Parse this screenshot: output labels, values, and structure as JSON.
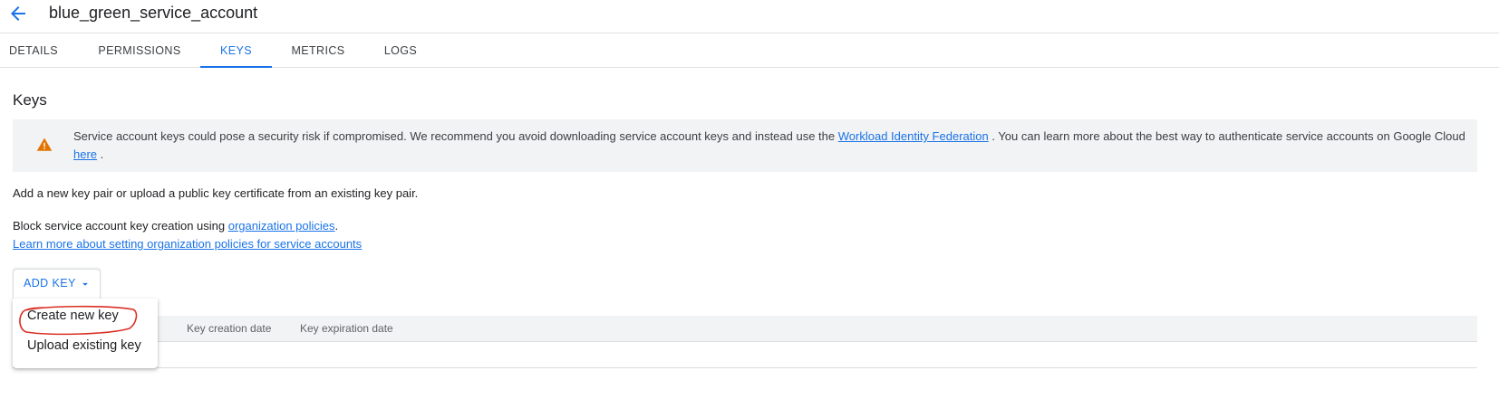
{
  "header": {
    "title": "blue_green_service_account",
    "back_icon": "arrow-back-icon"
  },
  "tabs": [
    {
      "label": "DETAILS",
      "active": false
    },
    {
      "label": "PERMISSIONS",
      "active": false
    },
    {
      "label": "KEYS",
      "active": true
    },
    {
      "label": "METRICS",
      "active": false
    },
    {
      "label": "LOGS",
      "active": false
    }
  ],
  "keys_section": {
    "title": "Keys",
    "warning": {
      "icon": "warning-icon",
      "text_before": "Service account keys could pose a security risk if compromised. We recommend you avoid downloading service account keys and instead use the ",
      "link1": "Workload Identity Federation",
      "text_middle": " . You can learn more about the best way to authenticate service accounts on Google Cloud ",
      "link2": "here",
      "text_after": " ."
    },
    "add_key_pair_text": "Add a new key pair or upload a public key certificate from an existing key pair.",
    "block_text": "Block service account key creation using ",
    "block_link": "organization policies",
    "block_text_after": ".",
    "learn_more_link": "Learn more about setting organization policies for service accounts",
    "add_key_button": "ADD KEY",
    "dropdown_items": [
      "Create new key",
      "Upload existing key"
    ],
    "table_columns": [
      "Key creation date",
      "Key expiration date"
    ]
  },
  "colors": {
    "accent": "#1a73e8",
    "warning": "#e37400",
    "annotation": "#d93025"
  }
}
